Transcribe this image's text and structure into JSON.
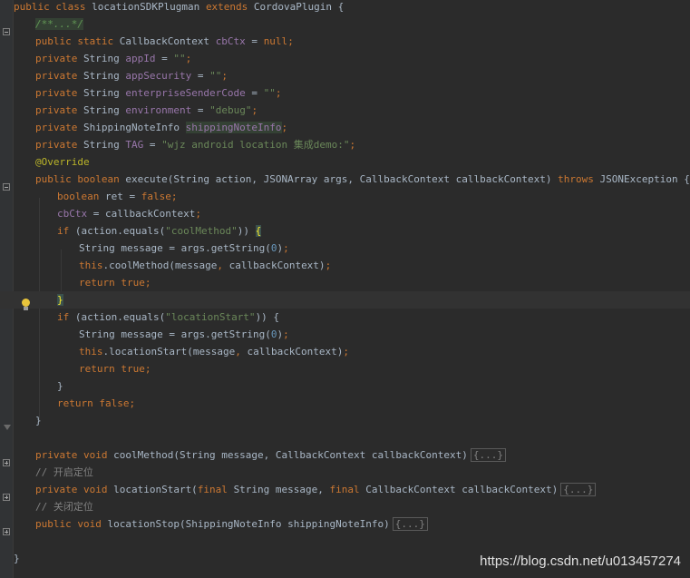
{
  "editor": {
    "lines": [
      {
        "segments": [
          {
            "t": "public class ",
            "c": "kw"
          },
          {
            "t": "locationSDKPlugman ",
            "c": ""
          },
          {
            "t": "extends ",
            "c": "kw"
          },
          {
            "t": "CordovaPlugin {",
            "c": ""
          }
        ]
      },
      {
        "segments": [
          {
            "t": "/**...*/",
            "c": "cmt-i hl"
          }
        ]
      },
      {
        "segments": [
          {
            "t": "public static ",
            "c": "kw"
          },
          {
            "t": "CallbackContext ",
            "c": ""
          },
          {
            "t": "cbCtx",
            "c": "fld"
          },
          {
            "t": " = ",
            "c": ""
          },
          {
            "t": "null",
            "c": "kw"
          },
          {
            "t": ";",
            "c": "kw"
          }
        ]
      },
      {
        "segments": [
          {
            "t": "private ",
            "c": "kw"
          },
          {
            "t": "String ",
            "c": ""
          },
          {
            "t": "appId",
            "c": "fld"
          },
          {
            "t": " = ",
            "c": ""
          },
          {
            "t": "\"\"",
            "c": "str"
          },
          {
            "t": ";",
            "c": "kw"
          }
        ]
      },
      {
        "segments": [
          {
            "t": "private ",
            "c": "kw"
          },
          {
            "t": "String ",
            "c": ""
          },
          {
            "t": "appSecurity",
            "c": "fld"
          },
          {
            "t": " = ",
            "c": ""
          },
          {
            "t": "\"\"",
            "c": "str"
          },
          {
            "t": ";",
            "c": "kw"
          }
        ]
      },
      {
        "segments": [
          {
            "t": "private ",
            "c": "kw"
          },
          {
            "t": "String ",
            "c": ""
          },
          {
            "t": "enterpriseSenderCode",
            "c": "fld"
          },
          {
            "t": " = ",
            "c": ""
          },
          {
            "t": "\"\"",
            "c": "str"
          },
          {
            "t": ";",
            "c": "kw"
          }
        ]
      },
      {
        "segments": [
          {
            "t": "private ",
            "c": "kw"
          },
          {
            "t": "String ",
            "c": ""
          },
          {
            "t": "environment",
            "c": "fld"
          },
          {
            "t": " = ",
            "c": ""
          },
          {
            "t": "\"debug\"",
            "c": "str"
          },
          {
            "t": ";",
            "c": "kw"
          }
        ]
      },
      {
        "segments": [
          {
            "t": "private ",
            "c": "kw"
          },
          {
            "t": "ShippingNoteInfo ",
            "c": ""
          },
          {
            "t": "shippingNoteInfo",
            "c": "fld hl"
          },
          {
            "t": ";",
            "c": "kw"
          }
        ]
      },
      {
        "segments": [
          {
            "t": "private ",
            "c": "kw"
          },
          {
            "t": "String ",
            "c": ""
          },
          {
            "t": "TAG",
            "c": "fld"
          },
          {
            "t": " = ",
            "c": ""
          },
          {
            "t": "\"wjz android location 集成demo:\"",
            "c": "str"
          },
          {
            "t": ";",
            "c": "kw"
          }
        ]
      },
      {
        "segments": [
          {
            "t": "@Override",
            "c": "ann"
          }
        ]
      },
      {
        "segments": [
          {
            "t": "public boolean ",
            "c": "kw"
          },
          {
            "t": "execute(String action, JSONArray args, CallbackContext callbackContext) ",
            "c": ""
          },
          {
            "t": "throws ",
            "c": "kw"
          },
          {
            "t": "JSONException {",
            "c": ""
          }
        ]
      },
      {
        "segments": [
          {
            "t": "boolean ",
            "c": "kw"
          },
          {
            "t": "ret = ",
            "c": ""
          },
          {
            "t": "false",
            "c": "kw"
          },
          {
            "t": ";",
            "c": "kw"
          }
        ]
      },
      {
        "segments": [
          {
            "t": "cbCtx",
            "c": "fld"
          },
          {
            "t": " = callbackContext",
            "c": ""
          },
          {
            "t": ";",
            "c": "kw"
          }
        ]
      },
      {
        "segments": [
          {
            "t": "if ",
            "c": "kw"
          },
          {
            "t": "(action.equals(",
            "c": ""
          },
          {
            "t": "\"coolMethod\"",
            "c": "str"
          },
          {
            "t": ")) ",
            "c": ""
          },
          {
            "t": "{",
            "c": "brace-hl"
          }
        ]
      },
      {
        "segments": [
          {
            "t": "String message = args.getString(",
            "c": ""
          },
          {
            "t": "0",
            "c": "num"
          },
          {
            "t": ")",
            "c": ""
          },
          {
            "t": ";",
            "c": "kw"
          }
        ]
      },
      {
        "segments": [
          {
            "t": "this",
            "c": "kw"
          },
          {
            "t": ".coolMethod(message",
            "c": ""
          },
          {
            "t": ", ",
            "c": "kw"
          },
          {
            "t": "callbackContext)",
            "c": ""
          },
          {
            "t": ";",
            "c": "kw"
          }
        ]
      },
      {
        "segments": [
          {
            "t": "return true;",
            "c": "kw"
          }
        ]
      },
      {
        "segments": [
          {
            "t": "}",
            "c": "brace-hl"
          }
        ]
      },
      {
        "segments": [
          {
            "t": "if ",
            "c": "kw"
          },
          {
            "t": "(action.equals(",
            "c": ""
          },
          {
            "t": "\"locationStart\"",
            "c": "str"
          },
          {
            "t": ")) {",
            "c": ""
          }
        ]
      },
      {
        "segments": [
          {
            "t": "String message = args.getString(",
            "c": ""
          },
          {
            "t": "0",
            "c": "num"
          },
          {
            "t": ")",
            "c": ""
          },
          {
            "t": ";",
            "c": "kw"
          }
        ]
      },
      {
        "segments": [
          {
            "t": "this",
            "c": "kw"
          },
          {
            "t": ".locationStart(message",
            "c": ""
          },
          {
            "t": ", ",
            "c": "kw"
          },
          {
            "t": "callbackContext)",
            "c": ""
          },
          {
            "t": ";",
            "c": "kw"
          }
        ]
      },
      {
        "segments": [
          {
            "t": "return true;",
            "c": "kw"
          }
        ]
      },
      {
        "segments": [
          {
            "t": "}",
            "c": ""
          }
        ]
      },
      {
        "segments": [
          {
            "t": "return false;",
            "c": "kw"
          }
        ]
      },
      {
        "segments": [
          {
            "t": "}",
            "c": ""
          }
        ]
      },
      {
        "segments": []
      },
      {
        "segments": [
          {
            "t": "private void ",
            "c": "kw"
          },
          {
            "t": "coolMethod(String message, CallbackContext callbackContext)",
            "c": ""
          },
          {
            "t": "{...}",
            "c": "fold-box"
          }
        ]
      },
      {
        "segments": [
          {
            "t": "// 开启定位",
            "c": "cmt"
          }
        ]
      },
      {
        "segments": [
          {
            "t": "private void ",
            "c": "kw"
          },
          {
            "t": "locationStart(",
            "c": ""
          },
          {
            "t": "final ",
            "c": "kw"
          },
          {
            "t": "String message, ",
            "c": ""
          },
          {
            "t": "final ",
            "c": "kw"
          },
          {
            "t": "CallbackContext callbackContext)",
            "c": ""
          },
          {
            "t": "{...}",
            "c": "fold-box"
          }
        ]
      },
      {
        "segments": [
          {
            "t": "// 关闭定位",
            "c": "cmt"
          }
        ]
      },
      {
        "segments": [
          {
            "t": "public void ",
            "c": "kw"
          },
          {
            "t": "locationStop(ShippingNoteInfo shippingNoteInfo)",
            "c": ""
          },
          {
            "t": "{...}",
            "c": "fold-box"
          }
        ]
      },
      {
        "segments": []
      },
      {
        "segments": [
          {
            "t": "}",
            "c": ""
          }
        ]
      }
    ]
  },
  "watermark": "https://blog.csdn.net/u013457274",
  "colors": {
    "background": "#2b2b2b",
    "keyword": "#cc7832",
    "string": "#6a8759",
    "field": "#9876aa",
    "annotation": "#bbb529",
    "comment": "#808080"
  }
}
